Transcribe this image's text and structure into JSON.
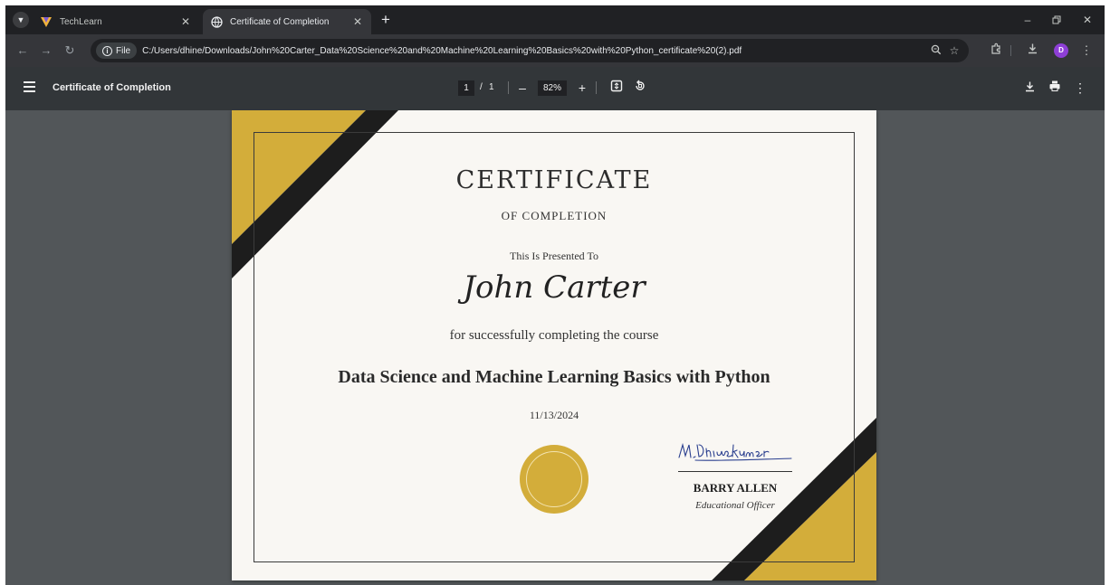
{
  "browser": {
    "tabs": [
      {
        "title": "TechLearn",
        "active": false
      },
      {
        "title": "Certificate of Completion",
        "active": true
      }
    ],
    "new_tab_label": "+",
    "address": {
      "chip_label": "File",
      "url": "C:/Users/dhine/Downloads/John%20Carter_Data%20Science%20and%20Machine%20Learning%20Basics%20with%20Python_certificate%20(2).pdf"
    },
    "profile_initial": "D"
  },
  "pdf_toolbar": {
    "title": "Certificate of Completion",
    "current_page": "1",
    "page_separator": "/",
    "total_pages": "1",
    "zoom": "82%"
  },
  "certificate": {
    "title": "CERTIFICATE",
    "subtitle": "OF COMPLETION",
    "presented_to": "This Is Presented To",
    "recipient": "John Carter",
    "completing_text": "for successfully completing the course",
    "course": "Data Science and Machine Learning Basics with Python",
    "date": "11/13/2024",
    "signature_text": "M.Dhinesh kumar",
    "signer_name": "BARRY ALLEN",
    "signer_role": "Educational Officer"
  },
  "colors": {
    "accent_gold": "#d3ad3a",
    "band_black": "#1d1d1d",
    "paper": "#f9f7f3",
    "viewer_bg": "#525659",
    "toolbar_bg": "#323639"
  },
  "icons": [
    "tab-list-icon",
    "techlearn-logo-icon",
    "globe-icon",
    "close-icon",
    "minimize-icon",
    "restore-icon",
    "back-icon",
    "forward-icon",
    "reload-icon",
    "info-icon",
    "zoom-icon",
    "star-icon",
    "extensions-icon",
    "download-icon",
    "more-icon",
    "menu-icon",
    "fit-page-icon",
    "rotate-icon",
    "print-icon"
  ]
}
